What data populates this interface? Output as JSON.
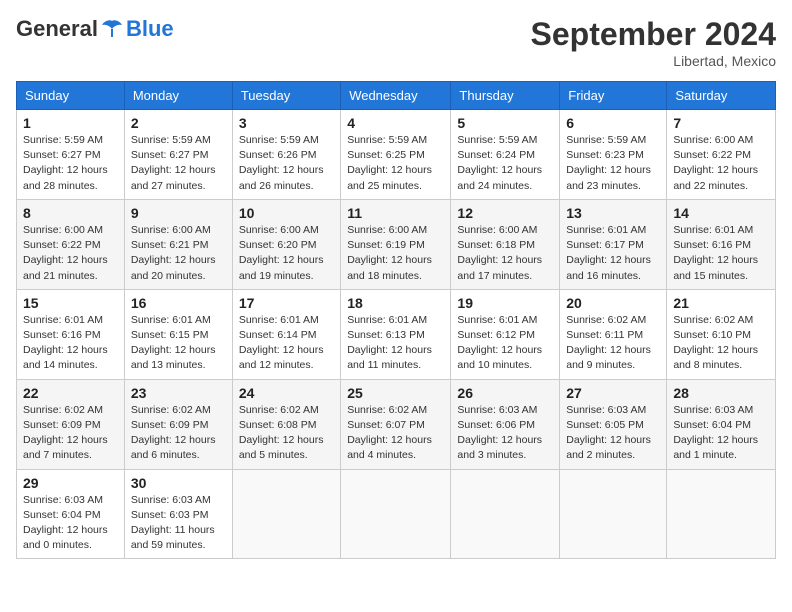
{
  "logo": {
    "general": "General",
    "blue": "Blue"
  },
  "header": {
    "month": "September 2024",
    "location": "Libertad, Mexico"
  },
  "weekdays": [
    "Sunday",
    "Monday",
    "Tuesday",
    "Wednesday",
    "Thursday",
    "Friday",
    "Saturday"
  ],
  "weeks": [
    [
      {
        "day": "1",
        "sunrise": "Sunrise: 5:59 AM",
        "sunset": "Sunset: 6:27 PM",
        "daylight": "Daylight: 12 hours and 28 minutes."
      },
      {
        "day": "2",
        "sunrise": "Sunrise: 5:59 AM",
        "sunset": "Sunset: 6:27 PM",
        "daylight": "Daylight: 12 hours and 27 minutes."
      },
      {
        "day": "3",
        "sunrise": "Sunrise: 5:59 AM",
        "sunset": "Sunset: 6:26 PM",
        "daylight": "Daylight: 12 hours and 26 minutes."
      },
      {
        "day": "4",
        "sunrise": "Sunrise: 5:59 AM",
        "sunset": "Sunset: 6:25 PM",
        "daylight": "Daylight: 12 hours and 25 minutes."
      },
      {
        "day": "5",
        "sunrise": "Sunrise: 5:59 AM",
        "sunset": "Sunset: 6:24 PM",
        "daylight": "Daylight: 12 hours and 24 minutes."
      },
      {
        "day": "6",
        "sunrise": "Sunrise: 5:59 AM",
        "sunset": "Sunset: 6:23 PM",
        "daylight": "Daylight: 12 hours and 23 minutes."
      },
      {
        "day": "7",
        "sunrise": "Sunrise: 6:00 AM",
        "sunset": "Sunset: 6:22 PM",
        "daylight": "Daylight: 12 hours and 22 minutes."
      }
    ],
    [
      {
        "day": "8",
        "sunrise": "Sunrise: 6:00 AM",
        "sunset": "Sunset: 6:22 PM",
        "daylight": "Daylight: 12 hours and 21 minutes."
      },
      {
        "day": "9",
        "sunrise": "Sunrise: 6:00 AM",
        "sunset": "Sunset: 6:21 PM",
        "daylight": "Daylight: 12 hours and 20 minutes."
      },
      {
        "day": "10",
        "sunrise": "Sunrise: 6:00 AM",
        "sunset": "Sunset: 6:20 PM",
        "daylight": "Daylight: 12 hours and 19 minutes."
      },
      {
        "day": "11",
        "sunrise": "Sunrise: 6:00 AM",
        "sunset": "Sunset: 6:19 PM",
        "daylight": "Daylight: 12 hours and 18 minutes."
      },
      {
        "day": "12",
        "sunrise": "Sunrise: 6:00 AM",
        "sunset": "Sunset: 6:18 PM",
        "daylight": "Daylight: 12 hours and 17 minutes."
      },
      {
        "day": "13",
        "sunrise": "Sunrise: 6:01 AM",
        "sunset": "Sunset: 6:17 PM",
        "daylight": "Daylight: 12 hours and 16 minutes."
      },
      {
        "day": "14",
        "sunrise": "Sunrise: 6:01 AM",
        "sunset": "Sunset: 6:16 PM",
        "daylight": "Daylight: 12 hours and 15 minutes."
      }
    ],
    [
      {
        "day": "15",
        "sunrise": "Sunrise: 6:01 AM",
        "sunset": "Sunset: 6:16 PM",
        "daylight": "Daylight: 12 hours and 14 minutes."
      },
      {
        "day": "16",
        "sunrise": "Sunrise: 6:01 AM",
        "sunset": "Sunset: 6:15 PM",
        "daylight": "Daylight: 12 hours and 13 minutes."
      },
      {
        "day": "17",
        "sunrise": "Sunrise: 6:01 AM",
        "sunset": "Sunset: 6:14 PM",
        "daylight": "Daylight: 12 hours and 12 minutes."
      },
      {
        "day": "18",
        "sunrise": "Sunrise: 6:01 AM",
        "sunset": "Sunset: 6:13 PM",
        "daylight": "Daylight: 12 hours and 11 minutes."
      },
      {
        "day": "19",
        "sunrise": "Sunrise: 6:01 AM",
        "sunset": "Sunset: 6:12 PM",
        "daylight": "Daylight: 12 hours and 10 minutes."
      },
      {
        "day": "20",
        "sunrise": "Sunrise: 6:02 AM",
        "sunset": "Sunset: 6:11 PM",
        "daylight": "Daylight: 12 hours and 9 minutes."
      },
      {
        "day": "21",
        "sunrise": "Sunrise: 6:02 AM",
        "sunset": "Sunset: 6:10 PM",
        "daylight": "Daylight: 12 hours and 8 minutes."
      }
    ],
    [
      {
        "day": "22",
        "sunrise": "Sunrise: 6:02 AM",
        "sunset": "Sunset: 6:09 PM",
        "daylight": "Daylight: 12 hours and 7 minutes."
      },
      {
        "day": "23",
        "sunrise": "Sunrise: 6:02 AM",
        "sunset": "Sunset: 6:09 PM",
        "daylight": "Daylight: 12 hours and 6 minutes."
      },
      {
        "day": "24",
        "sunrise": "Sunrise: 6:02 AM",
        "sunset": "Sunset: 6:08 PM",
        "daylight": "Daylight: 12 hours and 5 minutes."
      },
      {
        "day": "25",
        "sunrise": "Sunrise: 6:02 AM",
        "sunset": "Sunset: 6:07 PM",
        "daylight": "Daylight: 12 hours and 4 minutes."
      },
      {
        "day": "26",
        "sunrise": "Sunrise: 6:03 AM",
        "sunset": "Sunset: 6:06 PM",
        "daylight": "Daylight: 12 hours and 3 minutes."
      },
      {
        "day": "27",
        "sunrise": "Sunrise: 6:03 AM",
        "sunset": "Sunset: 6:05 PM",
        "daylight": "Daylight: 12 hours and 2 minutes."
      },
      {
        "day": "28",
        "sunrise": "Sunrise: 6:03 AM",
        "sunset": "Sunset: 6:04 PM",
        "daylight": "Daylight: 12 hours and 1 minute."
      }
    ],
    [
      {
        "day": "29",
        "sunrise": "Sunrise: 6:03 AM",
        "sunset": "Sunset: 6:04 PM",
        "daylight": "Daylight: 12 hours and 0 minutes."
      },
      {
        "day": "30",
        "sunrise": "Sunrise: 6:03 AM",
        "sunset": "Sunset: 6:03 PM",
        "daylight": "Daylight: 11 hours and 59 minutes."
      },
      null,
      null,
      null,
      null,
      null
    ]
  ]
}
